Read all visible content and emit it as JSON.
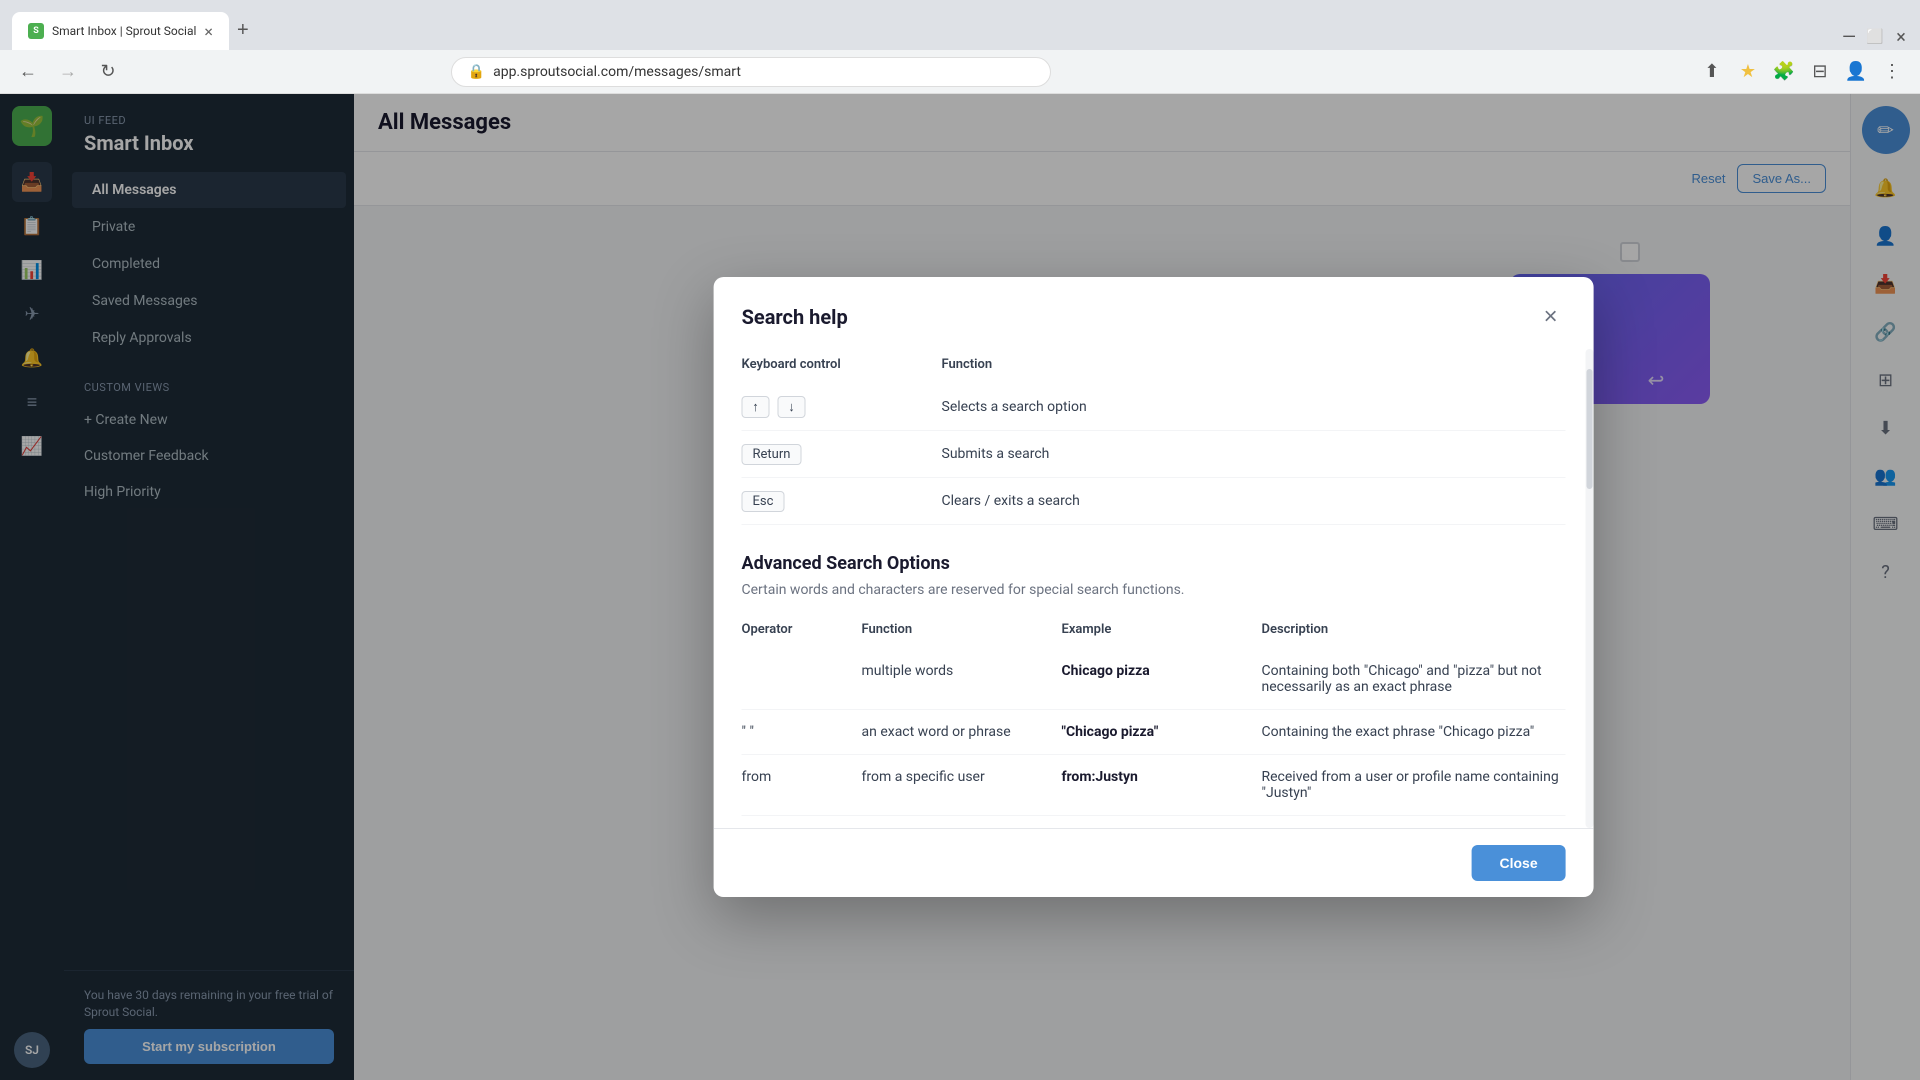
{
  "browser": {
    "tab_title": "Smart Inbox | Sprout Social",
    "tab_close": "×",
    "tab_add": "+",
    "address": "app.sproutsocial.com/messages/smart",
    "nav": {
      "back": "←",
      "forward": "→",
      "refresh": "↻"
    }
  },
  "sidebar": {
    "breadcrumb": "UI Feed",
    "title": "Smart Inbox",
    "nav_items": [
      {
        "label": "All Messages",
        "active": true
      },
      {
        "label": "Private"
      },
      {
        "label": "Completed"
      },
      {
        "label": "Saved Messages"
      },
      {
        "label": "Reply Approvals"
      }
    ],
    "custom_views_label": "Custom Views",
    "create_new_label": "+ Create New",
    "custom_items": [
      {
        "label": "Customer Feedback"
      },
      {
        "label": "High Priority"
      }
    ],
    "trial_text": "You have 30 days remaining in your free trial of Sprout Social.",
    "start_sub_label": "Start my subscription"
  },
  "main": {
    "title": "All Messages",
    "filter": {
      "reset_label": "Reset",
      "save_as_label": "Save As..."
    }
  },
  "modal": {
    "title": "Search help",
    "close_icon": "×",
    "keyboard_section": {
      "col1_header": "Keyboard control",
      "col2_header": "Function",
      "rows": [
        {
          "key": "arrows",
          "keys": [
            "↑",
            "↓"
          ],
          "function": "Selects a search option"
        },
        {
          "key": "return",
          "keys": [
            "Return"
          ],
          "function": "Submits a search"
        },
        {
          "key": "esc",
          "keys": [
            "Esc"
          ],
          "function": "Clears / exits a search"
        }
      ]
    },
    "advanced_section": {
      "title": "Advanced Search Options",
      "description": "Certain words and characters are reserved for special search functions.",
      "col_operator": "Operator",
      "col_function": "Function",
      "col_example": "Example",
      "col_description": "Description",
      "rows": [
        {
          "operator": "",
          "function": "multiple words",
          "example": "Chicago pizza",
          "description": "Containing both \"Chicago\" and \"pizza\" but not necessarily as an exact phrase"
        },
        {
          "operator": "\" \"",
          "function": "an exact word or phrase",
          "example": "\"Chicago pizza\"",
          "description": "Containing the exact phrase \"Chicago pizza\""
        },
        {
          "operator": "from",
          "function": "from a specific user",
          "example": "from:Justyn",
          "description": "Received from a user or profile name containing \"Justyn\""
        }
      ]
    },
    "close_button_label": "Close"
  },
  "right_panel": {
    "compose_icon": "✏",
    "notification_icon": "🔔",
    "link_icon": "🔗",
    "grid_icon": "⊞",
    "download_icon": "⬇",
    "team_icon": "👥",
    "keyboard_icon": "⌨",
    "help_icon": "?"
  }
}
